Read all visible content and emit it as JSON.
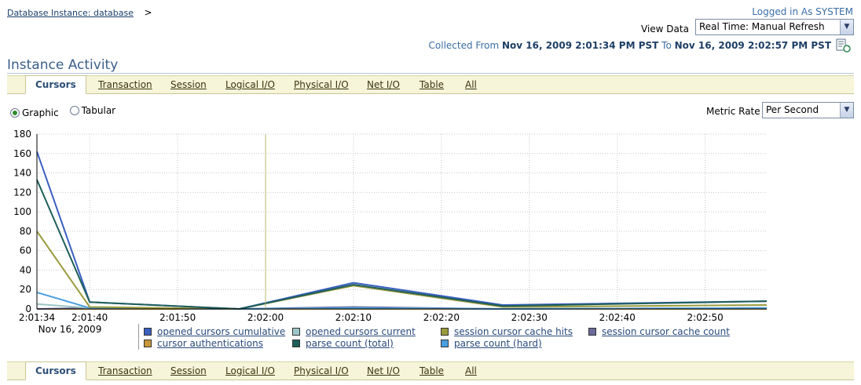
{
  "breadcrumb": {
    "link": "Database Instance: database",
    "separator": ">"
  },
  "header": {
    "logged_in": "Logged in As SYSTEM",
    "view_data_label": "View Data",
    "view_data_value": "Real Time: Manual Refresh",
    "collected_prefix": "Collected From",
    "collected_from": "Nov 16, 2009 2:01:34 PM PST",
    "collected_to_word": "To",
    "collected_to": "Nov 16, 2009 2:02:57 PM PST",
    "refresh_icon": "refresh-document-icon"
  },
  "page_title": "Instance Activity",
  "tabs": [
    "Cursors",
    "Transaction",
    "Session",
    "Logical I/O",
    "Physical I/O",
    "Net I/O",
    "Table",
    "All"
  ],
  "active_tab": "Cursors",
  "view_mode": {
    "graphic": "Graphic",
    "tabular": "Tabular",
    "selected": "Graphic"
  },
  "metric_rate": {
    "label": "Metric Rate",
    "value": "Per Second"
  },
  "chart_data": {
    "type": "line",
    "y_ticks": [
      0,
      20,
      40,
      60,
      80,
      100,
      120,
      140,
      160,
      180
    ],
    "ylim": [
      0,
      180
    ],
    "x_ticks": [
      "2:01:34",
      "2:01:40",
      "2:01:50",
      "2:02:00",
      "2:02:10",
      "2:02:20",
      "2:02:30",
      "2:02:40",
      "2:02:50"
    ],
    "x_sub_label": "Nov 16, 2009",
    "x_seconds": [
      0,
      6,
      16,
      26,
      36,
      46,
      56,
      66,
      76
    ],
    "x_max": 83,
    "grid": true,
    "series": [
      {
        "name": "opened cursors cumulative",
        "color": "#3a5fc0",
        "x": [
          0,
          6,
          23,
          36,
          53,
          83
        ],
        "y": [
          162,
          7,
          0,
          27,
          4,
          8
        ]
      },
      {
        "name": "opened cursors current",
        "color": "#9ec6c6",
        "x": [
          0,
          6,
          23,
          36,
          53,
          83
        ],
        "y": [
          5,
          1,
          0,
          1,
          0,
          1
        ]
      },
      {
        "name": "session cursor cache hits",
        "color": "#9a9a3c",
        "x": [
          0,
          6,
          23,
          36,
          53,
          83
        ],
        "y": [
          80,
          2,
          0,
          24,
          2,
          4
        ]
      },
      {
        "name": "session cursor cache count",
        "color": "#6a6a9a",
        "x": [
          0,
          6,
          23,
          36,
          53,
          83
        ],
        "y": [
          0,
          1,
          0,
          2,
          0,
          1
        ]
      },
      {
        "name": "cursor authentications",
        "color": "#c8963c",
        "x": [
          0,
          6,
          23,
          36,
          53,
          83
        ],
        "y": [
          0,
          0,
          0,
          0,
          0,
          0
        ]
      },
      {
        "name": "parse count (total)",
        "color": "#1e5f5a",
        "x": [
          0,
          6,
          23,
          36,
          53,
          83
        ],
        "y": [
          133,
          7,
          0,
          25,
          3,
          8
        ]
      },
      {
        "name": "parse count (hard)",
        "color": "#4a9fe0",
        "x": [
          0,
          6,
          23,
          36,
          53,
          83
        ],
        "y": [
          17,
          1,
          0,
          1,
          0,
          1
        ]
      }
    ]
  }
}
